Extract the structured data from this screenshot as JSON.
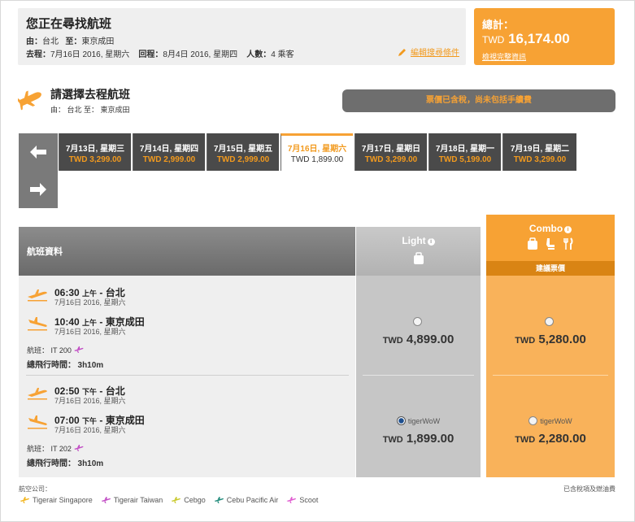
{
  "summary": {
    "title": "您正在尋找航班",
    "from_label": "由：",
    "from": "台北",
    "to_label": "至：",
    "to": "東京成田",
    "depart_label": "去程：",
    "depart_date": "7月16日 2016, 星期六",
    "return_label": "回程：",
    "return_date": "8月4日 2016, 星期四",
    "people_label": "人數：",
    "people": "4 乘客",
    "edit_link": "編輯搜尋條件"
  },
  "total": {
    "label": "總計：",
    "currency": "TWD",
    "amount": "16,174.00",
    "link": "檢視完整資訊"
  },
  "section": {
    "title": "請選擇去程航班",
    "route": "由： 台北 至： 東京成田",
    "notice": "票價已含稅，尚未包括手續費"
  },
  "date_tabs": [
    {
      "date": "7月13日, 星期三",
      "price": "TWD 3,299.00",
      "active": false
    },
    {
      "date": "7月14日, 星期四",
      "price": "TWD 2,999.00",
      "active": false
    },
    {
      "date": "7月15日, 星期五",
      "price": "TWD 2,999.00",
      "active": false
    },
    {
      "date": "7月16日, 星期六",
      "price": "TWD 1,899.00",
      "active": true
    },
    {
      "date": "7月17日, 星期日",
      "price": "TWD 3,299.00",
      "active": false
    },
    {
      "date": "7月18日, 星期一",
      "price": "TWD 5,199.00",
      "active": false
    },
    {
      "date": "7月19日, 星期二",
      "price": "TWD 3,299.00",
      "active": false
    }
  ],
  "table": {
    "info_header": "航班資料",
    "light_header": "Light",
    "combo_header": "Combo",
    "combo_sub": "建議票價"
  },
  "flights": [
    {
      "dep_time": "06:30",
      "dep_ampm": "上午",
      "dep_city": "台北",
      "dep_date": "7月16日 2016, 星期六",
      "arr_time": "10:40",
      "arr_ampm": "上午",
      "arr_city": "東京成田",
      "arr_date": "7月16日 2016, 星期六",
      "flight_label": "航班：",
      "flight_no": "IT 200",
      "duration_label": "總飛行時間：",
      "duration": "3h10m",
      "light_label": "",
      "light_currency": "TWD",
      "light_price": "4,899.00",
      "light_selected": false,
      "combo_label": "",
      "combo_currency": "TWD",
      "combo_price": "5,280.00",
      "combo_selected": false
    },
    {
      "dep_time": "02:50",
      "dep_ampm": "下午",
      "dep_city": "台北",
      "dep_date": "7月16日 2016, 星期六",
      "arr_time": "07:00",
      "arr_ampm": "下午",
      "arr_city": "東京成田",
      "arr_date": "7月16日 2016, 星期六",
      "flight_label": "航班：",
      "flight_no": "IT 202",
      "duration_label": "總飛行時間：",
      "duration": "3h10m",
      "light_label": "tigerWoW",
      "light_currency": "TWD",
      "light_price": "1,899.00",
      "light_selected": true,
      "combo_label": "tigerWoW",
      "combo_currency": "TWD",
      "combo_price": "2,280.00",
      "combo_selected": false
    }
  ],
  "legend": {
    "title": "航空公司：",
    "items": [
      {
        "name": "Tigerair Singapore",
        "color": "#f2b51e"
      },
      {
        "name": "Tigerair Taiwan",
        "color": "#c14cc4"
      },
      {
        "name": "Cebgo",
        "color": "#c8c82a"
      },
      {
        "name": "Cebu Pacific Air",
        "color": "#1f8a7a"
      },
      {
        "name": "Scoot",
        "color": "#e05ad0"
      }
    ],
    "tax_link": "已含稅項及燃油費"
  },
  "colors": {
    "accent": "#f7a234",
    "dark": "#4a4a4a",
    "combo_bg": "#f9b25a",
    "light_bg": "#c6c6c6"
  },
  "icons": {
    "prev": "arrow-left-icon",
    "next": "arrow-right-icon",
    "plane": "plane-icon",
    "edit": "pencil-icon"
  }
}
